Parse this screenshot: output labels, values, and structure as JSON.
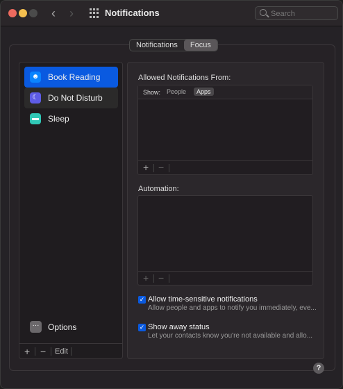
{
  "window": {
    "title": "Notifications",
    "search_placeholder": "Search"
  },
  "tabs": [
    {
      "label": "Notifications",
      "active": false
    },
    {
      "label": "Focus",
      "active": true
    }
  ],
  "sidebar": {
    "items": [
      {
        "label": "Book Reading",
        "icon": "smiley-icon",
        "color": "#0a84ff",
        "selected": true
      },
      {
        "label": "Do Not Disturb",
        "icon": "moon-icon",
        "color": "#5e5ce6",
        "selected": false
      },
      {
        "label": "Sleep",
        "icon": "bed-icon",
        "color": "#30c8b6",
        "selected": false
      }
    ],
    "options_label": "Options",
    "add_symbol": "+",
    "remove_symbol": "−",
    "edit_label": "Edit"
  },
  "detail": {
    "allowed_header": "Allowed Notifications From:",
    "show_label": "Show:",
    "show_tabs": [
      {
        "label": "People",
        "active": false
      },
      {
        "label": "Apps",
        "active": true
      }
    ],
    "automation_header": "Automation:",
    "add_symbol": "+",
    "remove_symbol": "−",
    "checkboxes": [
      {
        "label": "Allow time-sensitive notifications",
        "sub": "Allow people and apps to notify you immediately, eve...",
        "checked": true
      },
      {
        "label": "Show away status",
        "sub": "Let your contacts know you're not available and allo...",
        "checked": true
      }
    ]
  },
  "help_symbol": "?",
  "accent_color": "#0a5ae0"
}
